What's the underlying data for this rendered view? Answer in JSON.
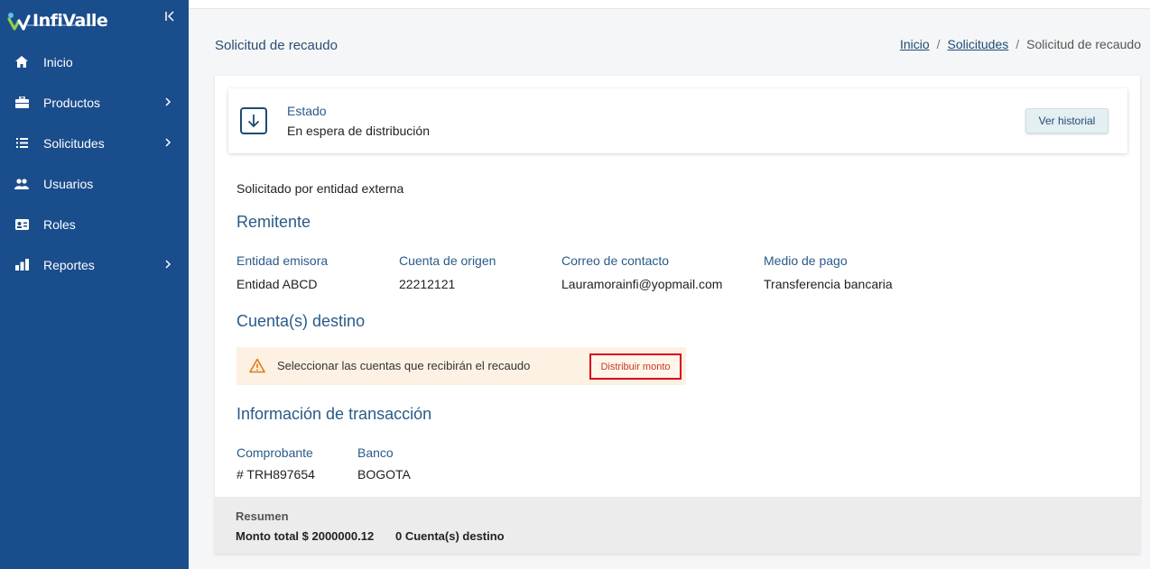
{
  "sidebar": {
    "logo_text": "InfiValle",
    "items": [
      {
        "label": "Inicio",
        "icon": "home-icon",
        "has_children": false
      },
      {
        "label": "Productos",
        "icon": "briefcase-icon",
        "has_children": true
      },
      {
        "label": "Solicitudes",
        "icon": "list-icon",
        "has_children": true
      },
      {
        "label": "Usuarios",
        "icon": "users-icon",
        "has_children": false
      },
      {
        "label": "Roles",
        "icon": "id-card-icon",
        "has_children": false
      },
      {
        "label": "Reportes",
        "icon": "chart-icon",
        "has_children": true
      }
    ]
  },
  "header": {
    "title": "Solicitud de recaudo",
    "breadcrumb": [
      "Inicio",
      "Solicitudes",
      "Solicitud de recaudo"
    ]
  },
  "status": {
    "label": "Estado",
    "value": "En espera de distribución",
    "history_button": "Ver historial"
  },
  "requested_by": "Solicitado por entidad externa",
  "sender": {
    "title": "Remitente",
    "fields": [
      {
        "label": "Entidad emisora",
        "value": "Entidad ABCD"
      },
      {
        "label": "Cuenta de origen",
        "value": "22212121"
      },
      {
        "label": "Correo de contacto",
        "value": "Lauramorainfi@yopmail.com"
      },
      {
        "label": "Medio de pago",
        "value": "Transferencia bancaria"
      }
    ]
  },
  "destination": {
    "title": "Cuenta(s) destino",
    "alert_text": "Seleccionar las cuentas que recibirán el recaudo",
    "distribute_button": "Distribuir monto"
  },
  "transaction": {
    "title": "Información de transacción",
    "fields": [
      {
        "label": "Comprobante",
        "value": "# TRH897654"
      },
      {
        "label": "Banco",
        "value": "BOGOTA"
      }
    ]
  },
  "summary": {
    "title": "Resumen",
    "total": "Monto total $ 2000000.12",
    "accounts": "0 Cuenta(s) destino"
  },
  "colors": {
    "sidebar": "#1a4d8c",
    "accent_text": "#2a5a8a",
    "alert_bg": "#fdf1e4",
    "highlight_border": "#d9001b"
  }
}
